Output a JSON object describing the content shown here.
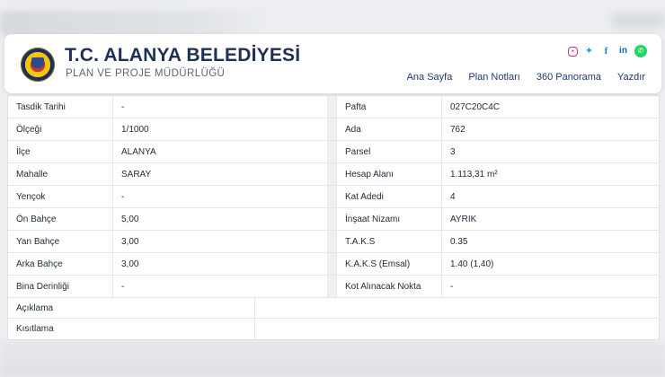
{
  "header": {
    "title": "T.C. ALANYA BELEDİYESİ",
    "subtitle": "PLAN VE PROJE MÜDÜRLÜĞÜ",
    "nav": [
      "Ana Sayfa",
      "Plan Notları",
      "360 Panorama",
      "Yazdır"
    ],
    "social_icons": [
      "instagram-icon",
      "twitter-icon",
      "facebook-icon",
      "linkedin-icon",
      "whatsapp-icon"
    ]
  },
  "table": {
    "rows": [
      {
        "l_label": "Tasdik Tarihi",
        "l_value": "-",
        "r_label": "Pafta",
        "r_value": "027C20C4C"
      },
      {
        "l_label": "Ölçeği",
        "l_value": "1/1000",
        "r_label": "Ada",
        "r_value": "762"
      },
      {
        "l_label": "İlçe",
        "l_value": "ALANYA",
        "r_label": "Parsel",
        "r_value": "3"
      },
      {
        "l_label": "Mahalle",
        "l_value": "SARAY",
        "r_label": "Hesap Alanı",
        "r_value": "1.113,31 m²"
      },
      {
        "l_label": "Yençok",
        "l_value": "-",
        "r_label": "Kat Adedi",
        "r_value": "4"
      },
      {
        "l_label": "Ön Bahçe",
        "l_value": "5,00",
        "r_label": "İnşaat Nizamı",
        "r_value": "AYRIK"
      },
      {
        "l_label": "Yan Bahçe",
        "l_value": "3,00",
        "r_label": "T.A.K.S",
        "r_value": "0.35"
      },
      {
        "l_label": "Arka Bahçe",
        "l_value": "3,00",
        "r_label": "K.A.K.S (Emsal)",
        "r_value": "1.40 (1,40)"
      },
      {
        "l_label": "Bina Derinliği",
        "l_value": "-",
        "r_label": "Kot Alınacak Nokta",
        "r_value": "-"
      }
    ],
    "wide_rows": [
      {
        "label": "Açıklama",
        "value": ""
      },
      {
        "label": "Kısıtlama",
        "value": ""
      }
    ]
  },
  "colors": {
    "title": "#1f2f55",
    "nav": "#1f3a72",
    "background": "#eceef1"
  }
}
